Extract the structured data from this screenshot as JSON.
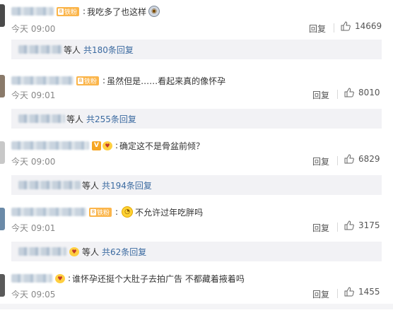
{
  "time_prefix": "今天",
  "reply_label": "回复",
  "badge": {
    "fan_label": "铁粉",
    "level_glyph": "8"
  },
  "comments": [
    {
      "text": "我吃多了也这样",
      "time": "09:00",
      "likes": "14669",
      "sub_people": "等人",
      "sub_total": "共180条回复"
    },
    {
      "text": "虽然但是……看起来真的像怀孕",
      "time": "09:01",
      "likes": "8010",
      "sub_people": "等人",
      "sub_total": "共255条回复"
    },
    {
      "text": "确定这不是骨盆前倾？",
      "time": "09:00",
      "likes": "6829",
      "sub_people": "等人",
      "sub_total": "共194条回复"
    },
    {
      "text": "不允许过年吃胖吗",
      "time": "09:01",
      "likes": "3175",
      "sub_people": "等人",
      "sub_total": "共62条回复"
    },
    {
      "text": "谁怀孕还挺个大肚子去拍广告 不都藏着掖着吗",
      "time": "09:05",
      "likes": "1455"
    }
  ],
  "colors": {
    "link": "#3b6aa0",
    "meta": "#888888",
    "subbox_bg": "#f2f2f5",
    "badge": "#fbb54a"
  }
}
